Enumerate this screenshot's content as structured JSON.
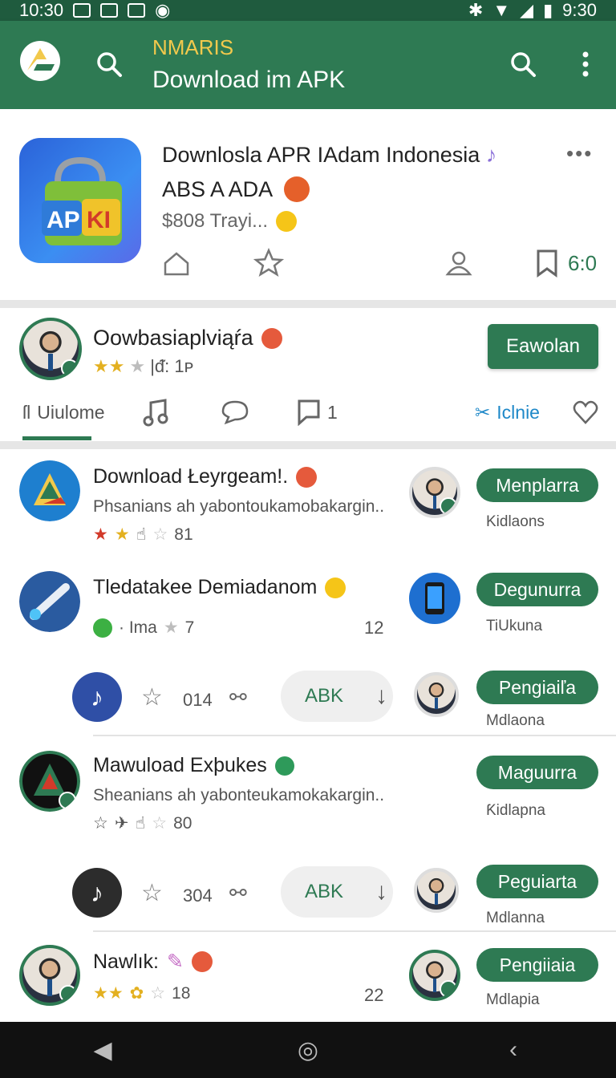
{
  "status_bar": {
    "time_left": "10:30",
    "time_right": "9:30"
  },
  "app_bar": {
    "subtitle": "NMARIS",
    "title": "Download im APK"
  },
  "feature": {
    "icon_text_a": "AP",
    "icon_text_b": "KI",
    "title": "Downlosla APR IAdam Indonesia",
    "subtitle": "ABS A ADA",
    "price": "$808 Trayi...",
    "more": "•••",
    "bookmark_count": "6:0"
  },
  "profile": {
    "name": "Oowbasiaplviąŕa",
    "rating_meta": "|ᵭ: 1ᴘ",
    "follow_label": "Eawolan",
    "tabs": {
      "home": "Uiulome",
      "comments_count": "1",
      "link": "Iclnie"
    }
  },
  "rows": [
    {
      "title": "Download Łeyrgeam!.",
      "desc": "Phsanians ah yabontoukamobakargin..",
      "meta": "81",
      "pill": "Menplarra",
      "pill_label": "Kidlaons"
    },
    {
      "title": "Tledatakee Demiadanom",
      "meta_text": "· Ima",
      "meta": "7",
      "num": "12",
      "pill": "Degunurra",
      "pill_label": "TiUkuna"
    },
    {
      "sub": true,
      "count": "014",
      "abk": "ABK",
      "pill": "Pengiaiľa",
      "pill_label": "Mdlaona"
    },
    {
      "title": "Mawuload Exþukes",
      "desc": "Sheanians ah yabonteukamokakargin..",
      "meta": "80",
      "pill": "Maguurra",
      "pill_label": "Ƙidlapna"
    },
    {
      "sub": true,
      "count": "304",
      "abk": "ABK",
      "pill": "Peguiarta",
      "pill_label": "Mdlanna"
    },
    {
      "title": "Nawlık:",
      "meta": "18",
      "num": "22",
      "pill": "Pengiiaia",
      "pill_label": "Mdlapia"
    }
  ],
  "colors": {
    "primary": "#2e7a53",
    "status_bar": "#1f5b3e",
    "accent_yellow": "#f2c94c",
    "link_blue": "#1e88c8"
  }
}
